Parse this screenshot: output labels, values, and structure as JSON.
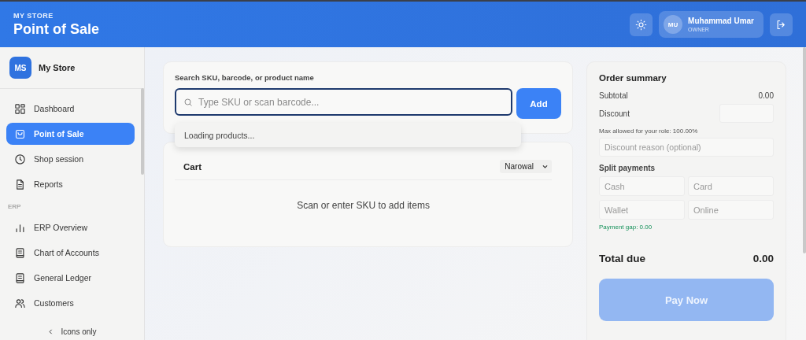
{
  "header": {
    "store": "MY STORE",
    "title": "Point of Sale",
    "user": {
      "initials": "MU",
      "name": "Muhammad Umar",
      "role": "OWNER"
    }
  },
  "sidebar": {
    "store": {
      "initials": "MS",
      "name": "My Store"
    },
    "sections": [
      {
        "items": [
          {
            "label": "Dashboard",
            "kind": "grid",
            "selected": false
          },
          {
            "label": "Point of Sale",
            "kind": "bag",
            "selected": true
          },
          {
            "label": "Shop session",
            "kind": "clock",
            "selected": false
          },
          {
            "label": "Reports",
            "kind": "doc",
            "selected": false
          }
        ]
      },
      {
        "heading": "ERP",
        "items": [
          {
            "label": "ERP Overview",
            "kind": "bars",
            "selected": false
          },
          {
            "label": "Chart of Accounts",
            "kind": "book",
            "selected": false
          },
          {
            "label": "General Ledger",
            "kind": "book",
            "selected": false
          },
          {
            "label": "Customers",
            "kind": "users",
            "selected": false
          }
        ]
      }
    ],
    "collapse": "Icons only"
  },
  "search": {
    "label": "Search SKU, barcode, or product name",
    "placeholder": "Type SKU or scan barcode...",
    "add": "Add",
    "dropdown": "Loading products..."
  },
  "cart": {
    "title": "Cart",
    "location": "Narowal",
    "empty": "Scan or enter SKU to add items"
  },
  "summary": {
    "title": "Order summary",
    "subtotal_label": "Subtotal",
    "subtotal": "0.00",
    "discount_label": "Discount",
    "discount_hint": "Max allowed for your role: 100.00%",
    "reason_placeholder": "Discount reason (optional)",
    "split_title": "Split payments",
    "payments": [
      {
        "placeholder": "Cash"
      },
      {
        "placeholder": "Card"
      },
      {
        "placeholder": "Wallet"
      },
      {
        "placeholder": "Online"
      }
    ],
    "gap": "Payment gap: 0.00",
    "total_label": "Total due",
    "total": "0.00",
    "pay": {
      "label": "Pay Now",
      "disabled": true
    }
  }
}
